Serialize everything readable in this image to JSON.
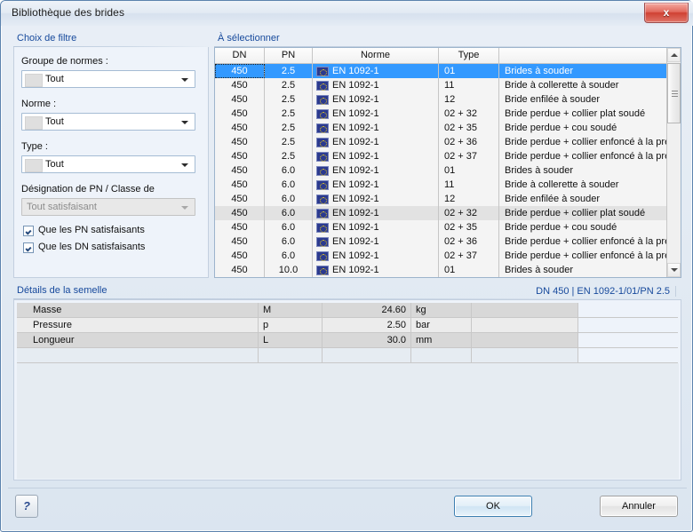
{
  "window": {
    "title": "Bibliothèque des brides",
    "close_label": "x"
  },
  "filter": {
    "caption": "Choix de filtre",
    "fields": [
      {
        "label": "Groupe de normes :",
        "value": "Tout",
        "disabled": false
      },
      {
        "label": "Norme :",
        "value": "Tout",
        "disabled": false
      },
      {
        "label": "Type :",
        "value": "Tout",
        "disabled": false
      },
      {
        "label": "Désignation de PN / Classe de",
        "value": "Tout satisfaisant",
        "disabled": true
      }
    ],
    "checkboxes": [
      {
        "label": "Que les PN satisfaisants",
        "checked": true
      },
      {
        "label": "Que les DN satisfaisants",
        "checked": true
      }
    ]
  },
  "selection": {
    "caption": "À sélectionner",
    "columns": [
      "DN",
      "PN",
      "Norme",
      "Type",
      ""
    ],
    "rows": [
      {
        "dn": "450",
        "pn": "2.5",
        "norme": "EN 1092-1",
        "type": "01",
        "desc": "Brides à souder",
        "selected": true,
        "alt": false
      },
      {
        "dn": "450",
        "pn": "2.5",
        "norme": "EN 1092-1",
        "type": "11",
        "desc": "Bride à collerette à souder",
        "selected": false,
        "alt": false
      },
      {
        "dn": "450",
        "pn": "2.5",
        "norme": "EN 1092-1",
        "type": "12",
        "desc": "Bride enfilée à souder",
        "selected": false,
        "alt": false
      },
      {
        "dn": "450",
        "pn": "2.5",
        "norme": "EN 1092-1",
        "type": "02 + 32",
        "desc": "Bride perdue + collier plat soudé",
        "selected": false,
        "alt": false
      },
      {
        "dn": "450",
        "pn": "2.5",
        "norme": "EN 1092-1",
        "type": "02 + 35",
        "desc": "Bride perdue + cou soudé",
        "selected": false,
        "alt": false
      },
      {
        "dn": "450",
        "pn": "2.5",
        "norme": "EN 1092-1",
        "type": "02 + 36",
        "desc": "Bride perdue + collier enfoncé à la presse à lon",
        "selected": false,
        "alt": false
      },
      {
        "dn": "450",
        "pn": "2.5",
        "norme": "EN 1092-1",
        "type": "02 + 37",
        "desc": "Bride perdue + collier enfoncé à la presse",
        "selected": false,
        "alt": false
      },
      {
        "dn": "450",
        "pn": "6.0",
        "norme": "EN 1092-1",
        "type": "01",
        "desc": "Brides à souder",
        "selected": false,
        "alt": false
      },
      {
        "dn": "450",
        "pn": "6.0",
        "norme": "EN 1092-1",
        "type": "11",
        "desc": "Bride à collerette à souder",
        "selected": false,
        "alt": false
      },
      {
        "dn": "450",
        "pn": "6.0",
        "norme": "EN 1092-1",
        "type": "12",
        "desc": "Bride enfilée à souder",
        "selected": false,
        "alt": false
      },
      {
        "dn": "450",
        "pn": "6.0",
        "norme": "EN 1092-1",
        "type": "02 + 32",
        "desc": "Bride perdue + collier plat soudé",
        "selected": false,
        "alt": true
      },
      {
        "dn": "450",
        "pn": "6.0",
        "norme": "EN 1092-1",
        "type": "02 + 35",
        "desc": "Bride perdue + cou soudé",
        "selected": false,
        "alt": false
      },
      {
        "dn": "450",
        "pn": "6.0",
        "norme": "EN 1092-1",
        "type": "02 + 36",
        "desc": "Bride perdue + collier enfoncé à la presse à lon",
        "selected": false,
        "alt": false
      },
      {
        "dn": "450",
        "pn": "6.0",
        "norme": "EN 1092-1",
        "type": "02 + 37",
        "desc": "Bride perdue + collier enfoncé à la presse",
        "selected": false,
        "alt": false
      },
      {
        "dn": "450",
        "pn": "10.0",
        "norme": "EN 1092-1",
        "type": "01",
        "desc": "Brides à souder",
        "selected": false,
        "alt": false
      }
    ]
  },
  "details": {
    "caption": "Détails de la semelle",
    "reference": "DN 450 | EN 1092-1/01/PN 2.5",
    "rows": [
      {
        "name": "Masse",
        "symbol": "M",
        "value": "24.60",
        "unit": "kg",
        "extra": ""
      },
      {
        "name": "Pressure",
        "symbol": "p",
        "value": "2.50",
        "unit": "bar",
        "extra": ""
      },
      {
        "name": "Longueur",
        "symbol": "L",
        "value": "30.0",
        "unit": "mm",
        "extra": ""
      }
    ]
  },
  "footer": {
    "help_label": "?",
    "ok_label": "OK",
    "cancel_label": "Annuler"
  }
}
